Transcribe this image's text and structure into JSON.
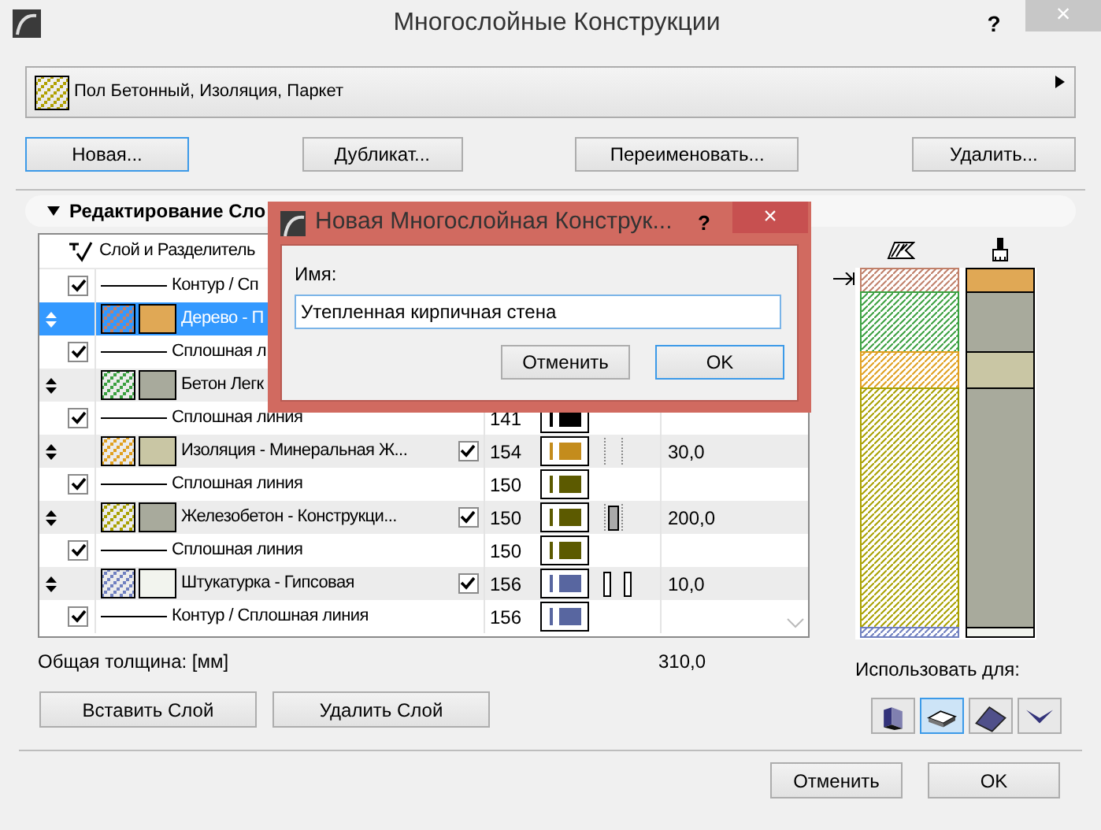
{
  "window": {
    "title": "Многослойные Конструкции",
    "help": "?",
    "close": "×"
  },
  "preset": {
    "label": "Пол Бетонный, Изоляция, Паркет"
  },
  "buttons": [
    {
      "label": "Новая...",
      "focused": true
    },
    {
      "label": "Дубликат...",
      "focused": false
    },
    {
      "label": "Переименовать...",
      "focused": false
    },
    {
      "label": "Удалить...",
      "focused": false
    }
  ],
  "section": {
    "title": "Редактирование Сло",
    "expanded": true
  },
  "table": {
    "columns": [
      "Слой и Разделитель"
    ],
    "rows": [
      {
        "kind": "separator",
        "checked": true,
        "name": "Контур / Сп",
        "selected": false
      },
      {
        "kind": "layer",
        "name": "Дерево - П",
        "selected": true,
        "hatch": {
          "color": "#c0806a"
        },
        "fill": {
          "color": "#e0a855"
        }
      },
      {
        "kind": "separator",
        "checked": true,
        "name": "Сплошная л",
        "selected": false
      },
      {
        "kind": "layer",
        "name": "Бетон Легк",
        "selected": false,
        "hatch": {
          "color": "#3aa040"
        },
        "fill": {
          "color": "#a8aa9c"
        }
      },
      {
        "kind": "separator",
        "checked": true,
        "name": "Сплошная линия",
        "pen": {
          "number": "141",
          "color": "#000000"
        },
        "selected": false
      },
      {
        "kind": "layer",
        "name": "Изоляция - Минеральная Ж...",
        "checked": true,
        "pen": {
          "number": "154",
          "color": "#c48c1c"
        },
        "type_icon": {
          "kind": "dotted"
        },
        "thickness": "30,0",
        "selected": false,
        "hatch": {
          "color": "#e0a020"
        },
        "fill": {
          "color": "#c9c6a4"
        }
      },
      {
        "kind": "separator",
        "checked": true,
        "name": "Сплошная линия",
        "pen": {
          "number": "150",
          "color": "#5c5a00"
        },
        "selected": false
      },
      {
        "kind": "layer",
        "name": "Железобетон - Конструкци...",
        "checked": true,
        "pen": {
          "number": "150",
          "color": "#5c5a00"
        },
        "type_icon": {
          "kind": "core"
        },
        "thickness": "200,0",
        "selected": false,
        "hatch": {
          "color": "#a8a000"
        },
        "fill": {
          "color": "#a8aa9c"
        }
      },
      {
        "kind": "separator",
        "checked": true,
        "name": "Сплошная линия",
        "pen": {
          "number": "150",
          "color": "#5c5a00"
        },
        "selected": false
      },
      {
        "kind": "layer",
        "name": "Штукатурка - Гипсовая",
        "checked": true,
        "pen": {
          "number": "156",
          "color": "#5866a0"
        },
        "type_icon": {
          "kind": "finish"
        },
        "thickness": "10,0",
        "selected": false,
        "hatch": {
          "color": "#7080c0"
        },
        "fill": {
          "color": "#f2f4ee"
        }
      },
      {
        "kind": "separator",
        "checked": true,
        "name": "Контур / Сплошная линия",
        "pen": {
          "number": "156",
          "color": "#5866a0"
        },
        "selected": false
      }
    ]
  },
  "total": {
    "label": "Общая толщина: [мм]",
    "value": "310,0"
  },
  "layer_buttons": [
    "Вставить Слой",
    "Удалить Слой"
  ],
  "use_for": {
    "label": "Использовать для:",
    "items": [
      {
        "kind": "wall",
        "selected": false
      },
      {
        "kind": "slab",
        "selected": true
      },
      {
        "kind": "roof",
        "selected": false
      },
      {
        "kind": "shell",
        "selected": false
      }
    ]
  },
  "footer_buttons": [
    {
      "label": "Отменить",
      "focused": false
    },
    {
      "label": "OK",
      "focused": false
    }
  ],
  "dialog": {
    "title": "Новая Многослойная Конструк...",
    "help": "?",
    "close": "×",
    "name_label": "Имя:",
    "name_value": "Утепленная кирпичная стена",
    "buttons": [
      {
        "label": "Отменить",
        "focused": false
      },
      {
        "label": "OK",
        "focused": true
      }
    ]
  }
}
